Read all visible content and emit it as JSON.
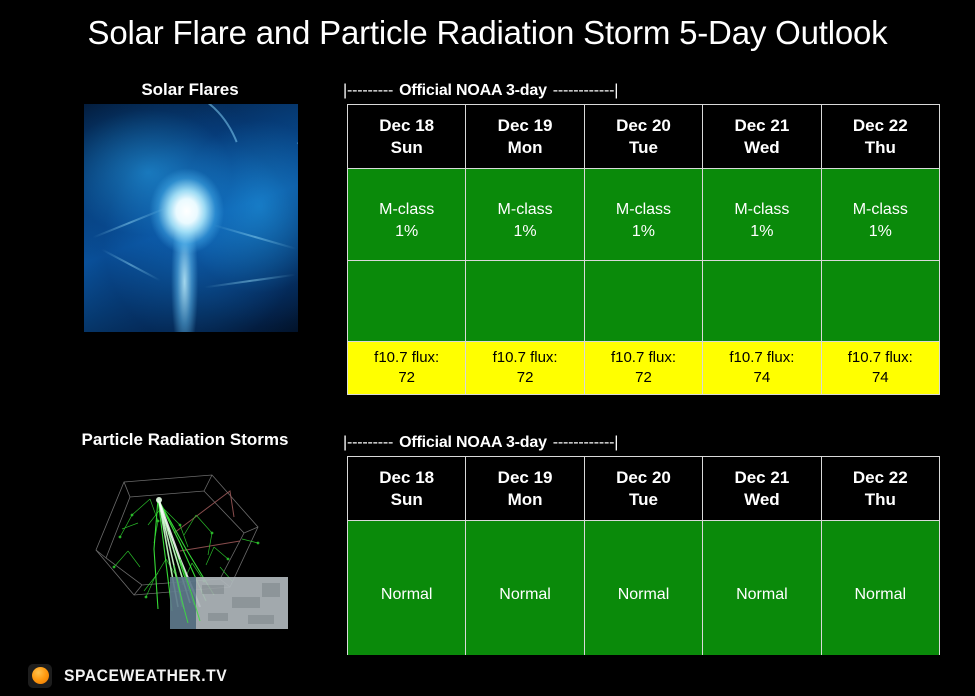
{
  "page": {
    "title": "Solar Flare and Particle Radiation Storm 5-Day Outlook",
    "background_color": "#000000"
  },
  "colors": {
    "green": "#0a8a0a",
    "yellow": "#ffff00",
    "black": "#000000",
    "border": "#d9d9d9",
    "logo_orange": "#ff9a10"
  },
  "sections": {
    "flares": {
      "caption": "Solar Flares",
      "image_name": "solar-flare-image",
      "noaa_bracket": "|--------- Official NOAA 3-day ------------|",
      "noaa_label": "Official NOAA 3-day",
      "noaa_dash_left": "|---------",
      "noaa_dash_right": "------------|",
      "days": [
        {
          "date": "Dec 18",
          "weekday": "Sun",
          "prob_class": "M-class",
          "prob_value": "1%",
          "flux_label": "f10.7 flux:",
          "flux_value": "72"
        },
        {
          "date": "Dec 19",
          "weekday": "Mon",
          "prob_class": "M-class",
          "prob_value": "1%",
          "flux_label": "f10.7 flux:",
          "flux_value": "72"
        },
        {
          "date": "Dec 20",
          "weekday": "Tue",
          "prob_class": "M-class",
          "prob_value": "1%",
          "flux_label": "f10.7 flux:",
          "flux_value": "72"
        },
        {
          "date": "Dec 21",
          "weekday": "Wed",
          "prob_class": "M-class",
          "prob_value": "1%",
          "flux_label": "f10.7 flux:",
          "flux_value": "74"
        },
        {
          "date": "Dec 22",
          "weekday": "Thu",
          "prob_class": "M-class",
          "prob_value": "1%",
          "flux_label": "f10.7 flux:",
          "flux_value": "74"
        }
      ]
    },
    "particles": {
      "caption": "Particle Radiation Storms",
      "image_name": "particle-shower-image",
      "noaa_bracket": "|--------- Official NOAA 3-day ------------|",
      "noaa_label": "Official NOAA 3-day",
      "noaa_dash_left": "|---------",
      "noaa_dash_right": "------------|",
      "days": [
        {
          "date": "Dec 18",
          "weekday": "Sun",
          "status": "Normal"
        },
        {
          "date": "Dec 19",
          "weekday": "Mon",
          "status": "Normal"
        },
        {
          "date": "Dec 20",
          "weekday": "Tue",
          "status": "Normal"
        },
        {
          "date": "Dec 21",
          "weekday": "Wed",
          "status": "Normal"
        },
        {
          "date": "Dec 22",
          "weekday": "Thu",
          "status": "Normal"
        }
      ]
    }
  },
  "footer": {
    "logo_icon": "sun-circle-icon",
    "brand": "SPACEWEATHER.TV"
  }
}
